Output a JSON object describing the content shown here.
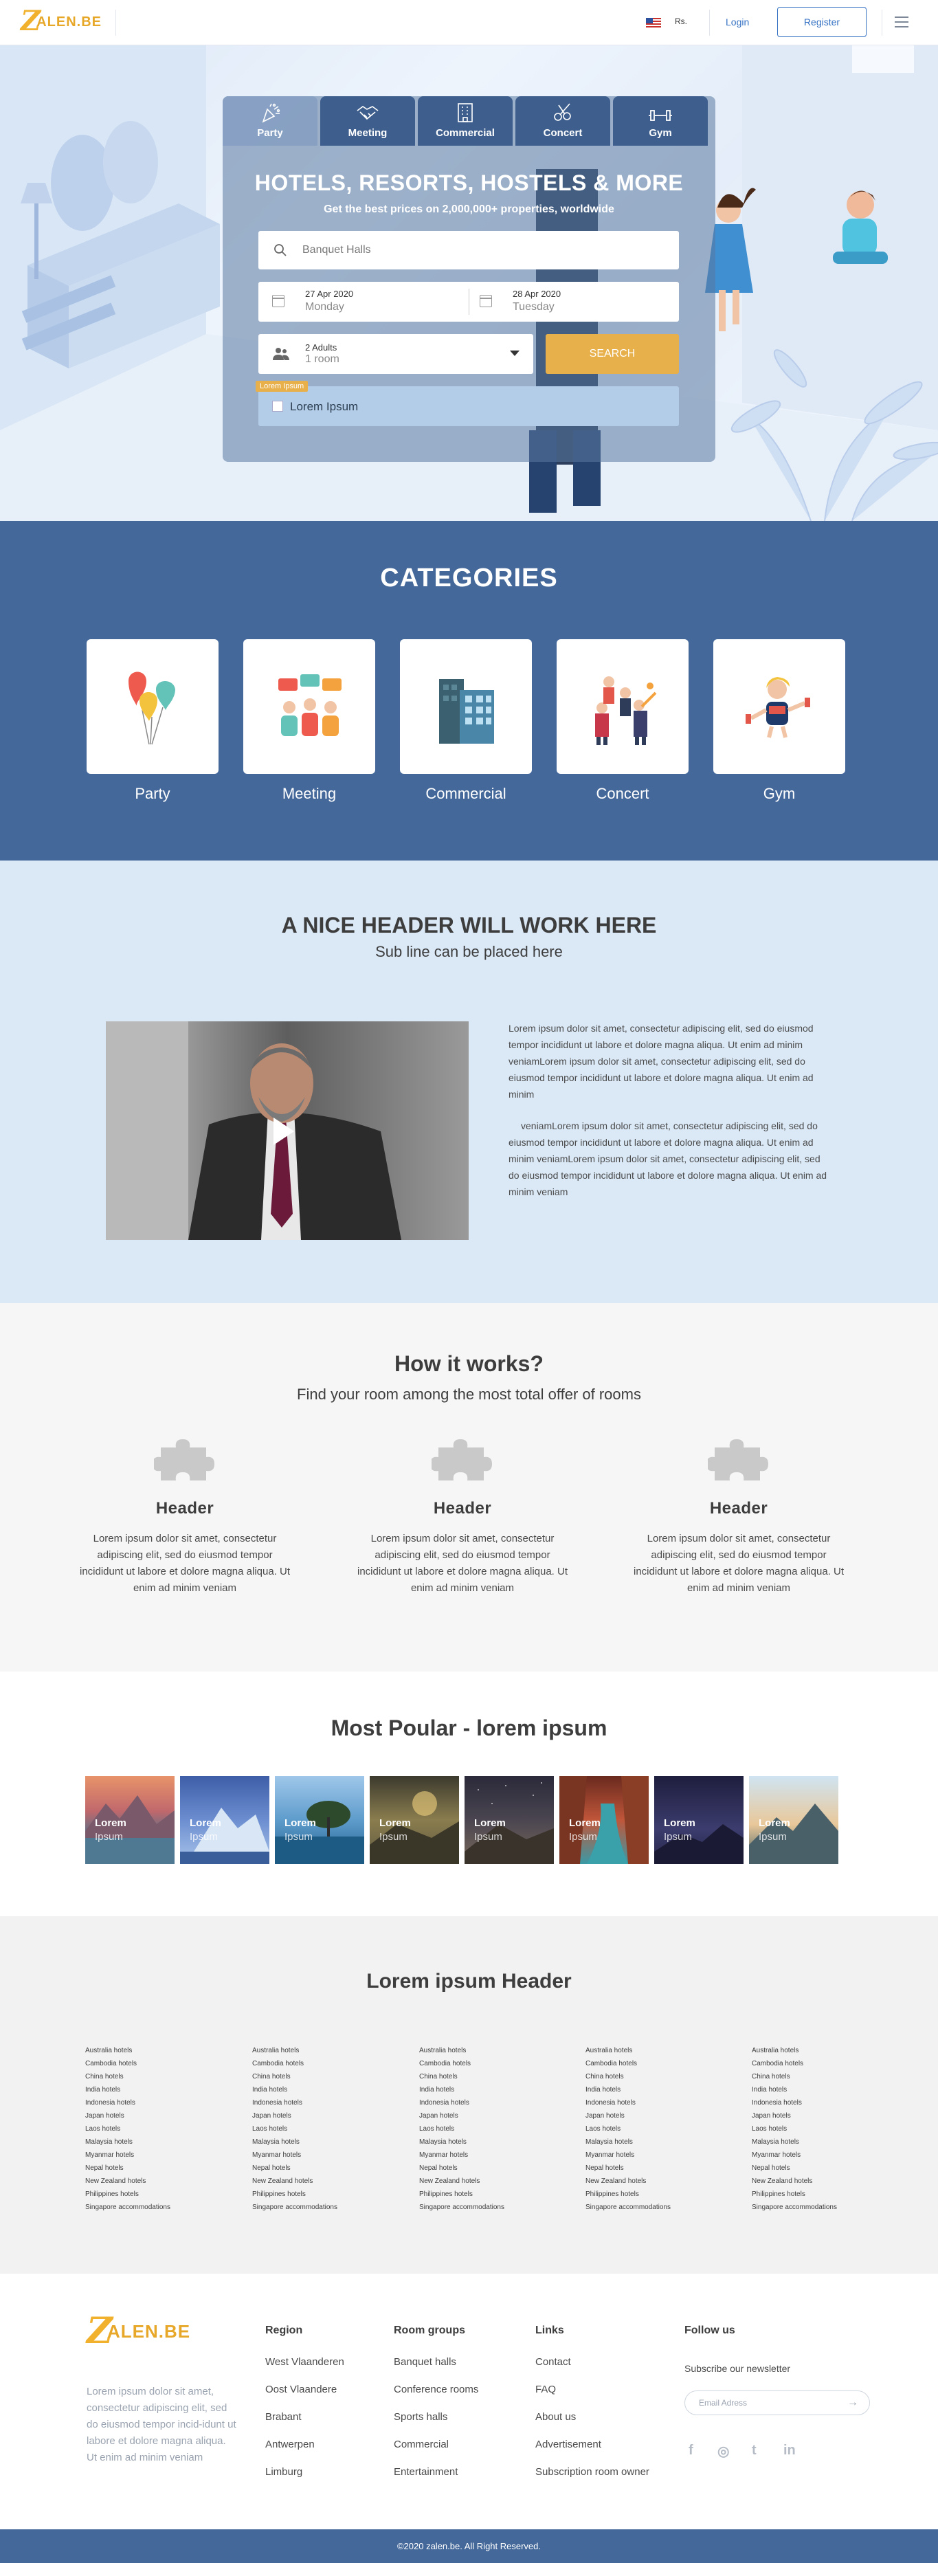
{
  "header": {
    "logo_z": "Z",
    "logo_rest": "ALEN.BE",
    "currency": "Rs.",
    "login": "Login",
    "register": "Register",
    "flag_icon": "us-flag-icon",
    "menu_icon": "hamburger-menu-icon"
  },
  "hero": {
    "tabs": [
      {
        "label": "Party",
        "icon": "party-popper-icon"
      },
      {
        "label": "Meeting",
        "icon": "handshake-icon"
      },
      {
        "label": "Commercial",
        "icon": "building-icon"
      },
      {
        "label": "Concert",
        "icon": "guitars-icon"
      },
      {
        "label": "Gym",
        "icon": "dumbbell-icon"
      }
    ],
    "title": "HOTELS, RESORTS, HOSTELS & MORE",
    "subtitle": "Get the best prices on 2,000,000+ properties, worldwide",
    "destination_placeholder": "Banquet Halls",
    "checkin_date": "27 Apr 2020",
    "checkin_day": "Monday",
    "checkout_date": "28 Apr 2020",
    "checkout_day": "Tuesday",
    "guests_adults": "2 Adults",
    "guests_rooms": "1 room",
    "search_label": "SEARCH",
    "tag_label": "Lorem Ipsum",
    "checkbox_label": "Lorem Ipsum"
  },
  "categories": {
    "title": "CATEGORIES",
    "items": [
      {
        "label": "Party",
        "icon": "balloons-icon"
      },
      {
        "label": "Meeting",
        "icon": "meeting-people-icon"
      },
      {
        "label": "Commercial",
        "icon": "office-building-icon"
      },
      {
        "label": "Concert",
        "icon": "concert-band-icon"
      },
      {
        "label": "Gym",
        "icon": "gym-woman-icon"
      }
    ]
  },
  "nice": {
    "title": "A NICE HEADER WILL WORK HERE",
    "subtitle": "Sub line can be placed here",
    "paragraph1": "Lorem ipsum dolor sit amet, consectetur adipiscing elit, sed do eiusmod tempor incididunt ut labore et dolore magna aliqua. Ut enim ad minim veniamLorem ipsum dolor sit amet, consectetur adipiscing elit, sed do eiusmod tempor incididunt ut labore et dolore magna aliqua. Ut enim ad minim",
    "paragraph2": "veniamLorem ipsum dolor sit amet, consectetur adipiscing elit, sed do eiusmod tempor incididunt ut labore et dolore magna aliqua. Ut enim ad minim veniamLorem ipsum dolor sit amet, consectetur adipiscing elit, sed do eiusmod tempor incididunt ut labore et dolore magna aliqua. Ut enim ad minim veniam",
    "video_play_icon": "play-icon"
  },
  "how": {
    "title": "How it works?",
    "subtitle": "Find  your room among the most total offer of rooms",
    "steps": [
      {
        "header": "Header",
        "text": "Lorem ipsum dolor sit amet, consectetur adipiscing elit, sed do eiusmod tempor incididunt ut labore et dolore magna aliqua. Ut enim ad minim veniam",
        "icon": "puzzle-icon"
      },
      {
        "header": "Header",
        "text": "Lorem ipsum dolor sit amet, consectetur adipiscing elit, sed do eiusmod tempor incididunt ut labore et dolore magna aliqua. Ut enim ad minim veniam",
        "icon": "puzzle-icon"
      },
      {
        "header": "Header",
        "text": "Lorem ipsum dolor sit amet, consectetur adipiscing elit, sed do eiusmod tempor incididunt ut labore et dolore magna aliqua. Ut enim ad minim veniam",
        "icon": "puzzle-icon"
      }
    ]
  },
  "popular": {
    "title": "Most Poular - lorem ipsum",
    "tiles": [
      {
        "line1": "Lorem",
        "line2": "Ipsum"
      },
      {
        "line1": "Lorem",
        "line2": "Ipsum"
      },
      {
        "line1": "Lorem",
        "line2": "Ipsum"
      },
      {
        "line1": "Lorem",
        "line2": "Ipsum"
      },
      {
        "line1": "Lorem",
        "line2": "Ipsum"
      },
      {
        "line1": "Lorem",
        "line2": "Ipsum"
      },
      {
        "line1": "Lorem",
        "line2": "Ipsum"
      },
      {
        "line1": "Lorem",
        "line2": "Ipsum"
      }
    ]
  },
  "links": {
    "title": "Lorem ipsum Header",
    "items": [
      "Australia hotels",
      "Cambodia hotels",
      "China hotels",
      "India hotels",
      "Indonesia hotels",
      "Japan hotels",
      "Laos hotels",
      "Malaysia hotels",
      "Myanmar hotels",
      "Nepal hotels",
      "New Zealand hotels",
      "Philippines hotels",
      "Singapore accommodations"
    ]
  },
  "footer": {
    "logo_z": "Z",
    "logo_rest": "ALEN.BE",
    "description": "Lorem ipsum dolor sit amet, consectetur adipiscing elit, sed do eiusmod tempor incid-idunt ut labore et dolore magna aliqua. Ut enim ad minim veniam",
    "region": {
      "title": "Region",
      "items": [
        "West Vlaanderen",
        "Oost Vlaandere",
        "Brabant",
        "Antwerpen",
        "Limburg"
      ]
    },
    "room_groups": {
      "title": "Room groups",
      "items": [
        "Banquet halls",
        "Conference rooms",
        "Sports halls",
        "Commercial",
        "Entertainment"
      ]
    },
    "links": {
      "title": "Links",
      "items": [
        "Contact",
        "FAQ",
        "About us",
        "Advertisement",
        "Subscription room owner"
      ]
    },
    "follow": {
      "title": "Follow us",
      "newsletter": "Subscribe our newsletter",
      "email_placeholder": "Email Adress"
    },
    "social": [
      "f",
      "◎",
      "t",
      "in"
    ],
    "copyright": "©2020 zalen.be. All Right Reserved."
  }
}
